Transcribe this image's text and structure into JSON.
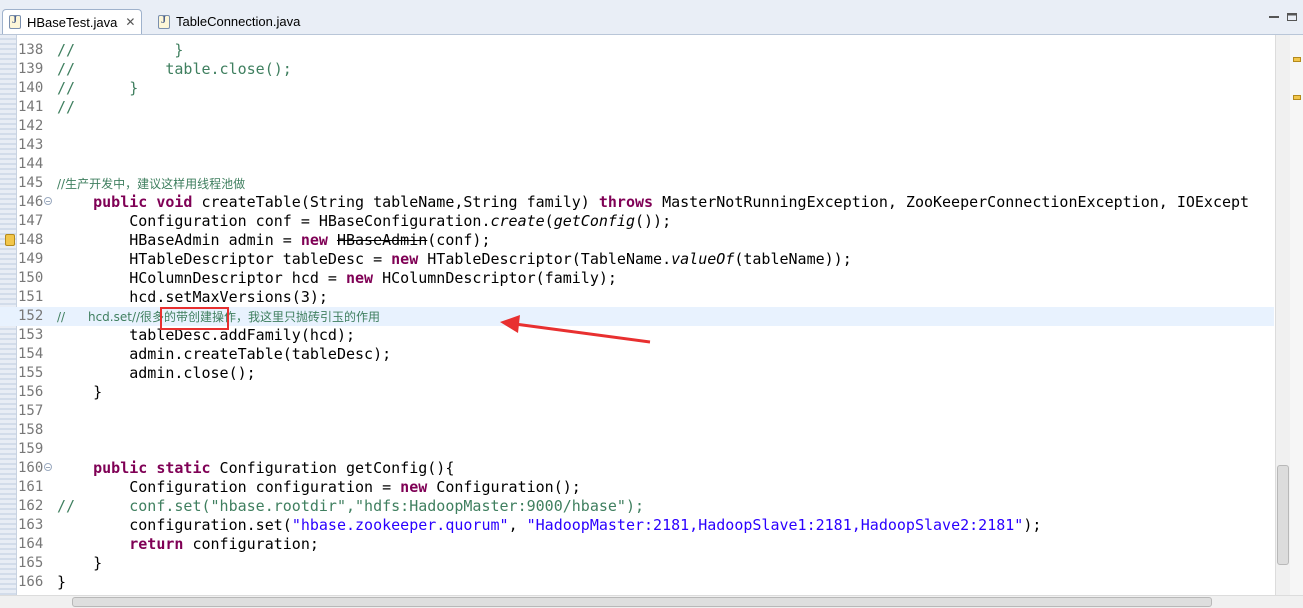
{
  "tabs": [
    {
      "label": "HBaseTest.java",
      "active": true,
      "close": "✕"
    },
    {
      "label": "TableConnection.java",
      "active": false
    }
  ],
  "editor": {
    "lines": [
      {
        "n": "138",
        "text": "//           }"
      },
      {
        "n": "139",
        "text": "//          table.close();"
      },
      {
        "n": "140",
        "text": "//      }"
      },
      {
        "n": "141",
        "text": "//"
      },
      {
        "n": "142",
        "text": ""
      },
      {
        "n": "143",
        "text": ""
      },
      {
        "n": "144",
        "text": ""
      },
      {
        "n": "145",
        "text": "//生产开发中，建议这样用线程池做"
      },
      {
        "n": "146",
        "text": "    public void createTable(String tableName,String family) throws MasterNotRunningException, ZooKeeperConnectionException, IOExcept"
      },
      {
        "n": "147",
        "text": "        Configuration conf = HBaseConfiguration.create(getConfig());"
      },
      {
        "n": "148",
        "text": "        HBaseAdmin admin = new HBaseAdmin(conf);"
      },
      {
        "n": "149",
        "text": "        HTableDescriptor tableDesc = new HTableDescriptor(TableName.valueOf(tableName));"
      },
      {
        "n": "150",
        "text": "        HColumnDescriptor hcd = new HColumnDescriptor(family);"
      },
      {
        "n": "151",
        "text": "        hcd.setMaxVersions(3);"
      },
      {
        "n": "152",
        "text": "//      hcd.set//很多的带创建操作，我这里只抛砖引玉的作用"
      },
      {
        "n": "153",
        "text": "        tableDesc.addFamily(hcd);"
      },
      {
        "n": "154",
        "text": "        admin.createTable(tableDesc);"
      },
      {
        "n": "155",
        "text": "        admin.close();"
      },
      {
        "n": "156",
        "text": "    }"
      },
      {
        "n": "157",
        "text": ""
      },
      {
        "n": "158",
        "text": ""
      },
      {
        "n": "159",
        "text": ""
      },
      {
        "n": "160",
        "text": "    public static Configuration getConfig(){"
      },
      {
        "n": "161",
        "text": "        Configuration configuration = new Configuration();"
      },
      {
        "n": "162",
        "text": "//      conf.set(\"hbase.rootdir\",\"hdfs:HadoopMaster:9000/hbase\");"
      },
      {
        "n": "163",
        "text": "        configuration.set(\"hbase.zookeeper.quorum\", \"HadoopMaster:2181,HadoopSlave1:2181,HadoopSlave2:2181\");"
      },
      {
        "n": "164",
        "text": "        return configuration;"
      },
      {
        "n": "165",
        "text": "    }"
      },
      {
        "n": "166",
        "text": "}"
      }
    ],
    "current_line": "152"
  },
  "icons": {
    "tab_file": "java-file-icon",
    "fold": "fold-minus-icon",
    "warning": "warning-marker-icon"
  },
  "colors": {
    "comment": "#3f7f5f",
    "keyword": "#7f0055",
    "string": "#2a00ff",
    "annotation": "#e83030"
  }
}
